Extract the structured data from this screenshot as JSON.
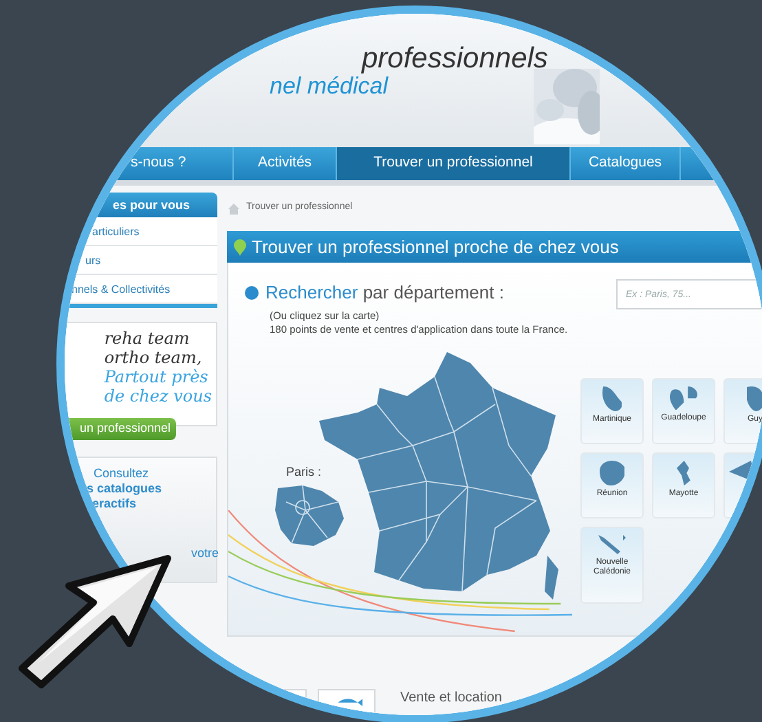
{
  "header": {
    "title": "professionnels",
    "subtitle": "nel médical"
  },
  "nav": [
    {
      "label": "s-nous ?",
      "selected": false
    },
    {
      "label": "Activités",
      "selected": false
    },
    {
      "label": "Trouver un professionnel",
      "selected": true
    },
    {
      "label": "Catalogues",
      "selected": false
    }
  ],
  "sidebar": {
    "heading": "es pour vous",
    "items": [
      "articuliers",
      "urs",
      "nnels & Collectivités"
    ],
    "banner": {
      "lines": [
        "reha team",
        "ortho team,",
        "Partout près",
        "de chez vous"
      ],
      "button": "un professionnel"
    },
    "catalog": {
      "lines": [
        "Consultez",
        "s catalogues",
        "eractifs"
      ],
      "link": "votre"
    }
  },
  "breadcrumb": "Trouver un professionnel",
  "panel": {
    "title": "Trouver un professionnel proche de chez vous",
    "search_heading": {
      "highlight": "Rechercher",
      "rest": "par département :"
    },
    "hint": "(Ou cliquez sur la carte)",
    "info": "180 points de vente et centres d'application dans toute la France.",
    "search": {
      "placeholder": "Ex : Paris, 75..."
    },
    "paris_label": "Paris :",
    "territories": [
      {
        "kind": "labeled",
        "label": "Martinique"
      },
      {
        "kind": "labeled",
        "label": "Guadeloupe"
      },
      {
        "kind": "labeled",
        "label": "Guy"
      },
      {
        "kind": "labeled",
        "label": "Réunion"
      },
      {
        "kind": "labeled",
        "label": "Mayotte"
      },
      {
        "kind": "blank"
      },
      {
        "kind": "labeled",
        "label": "Nouvelle Calédonie"
      }
    ]
  },
  "footer_text": "Vente et location"
}
